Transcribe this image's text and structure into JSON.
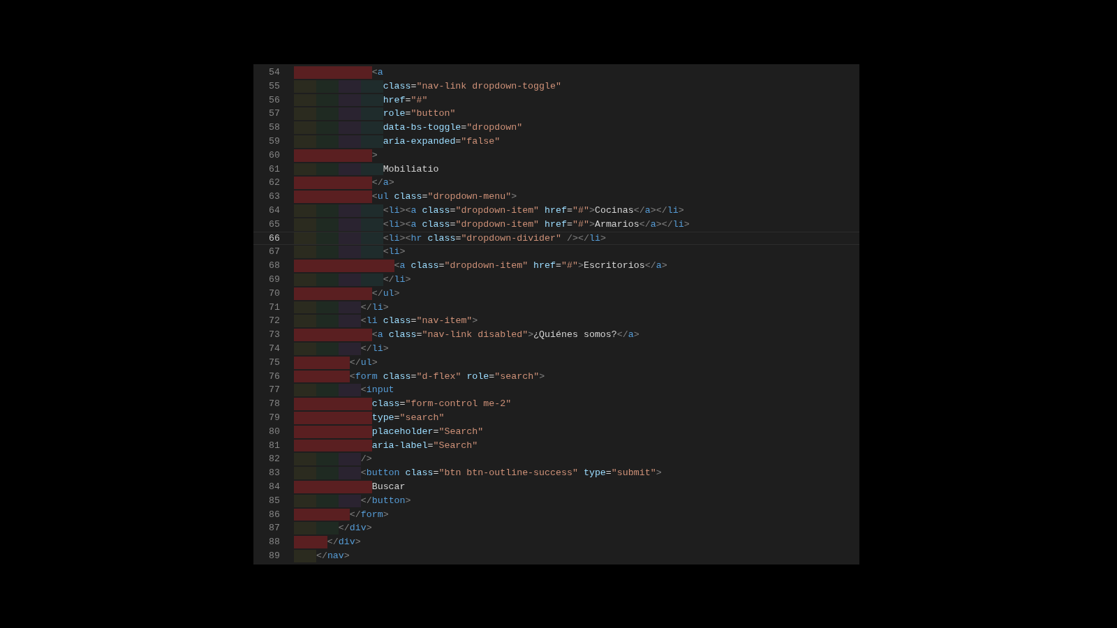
{
  "editor": {
    "lines": [
      {
        "number": "54",
        "current": false,
        "indent_error": true,
        "tokens": [
          {
            "kind": "punct",
            "text": "              <"
          },
          {
            "kind": "tag",
            "text": "a"
          }
        ]
      },
      {
        "number": "55",
        "current": false,
        "indent_error": false,
        "tokens": [
          {
            "kind": "attr",
            "text": "                class"
          },
          {
            "kind": "text",
            "text": "="
          },
          {
            "kind": "string",
            "text": "\"nav-link dropdown-toggle\""
          }
        ]
      },
      {
        "number": "56",
        "current": false,
        "indent_error": false,
        "tokens": [
          {
            "kind": "attr",
            "text": "                href"
          },
          {
            "kind": "text",
            "text": "="
          },
          {
            "kind": "string",
            "text": "\"#\""
          }
        ]
      },
      {
        "number": "57",
        "current": false,
        "indent_error": false,
        "tokens": [
          {
            "kind": "attr",
            "text": "                role"
          },
          {
            "kind": "text",
            "text": "="
          },
          {
            "kind": "string",
            "text": "\"button\""
          }
        ]
      },
      {
        "number": "58",
        "current": false,
        "indent_error": false,
        "tokens": [
          {
            "kind": "attr",
            "text": "                data-bs-toggle"
          },
          {
            "kind": "text",
            "text": "="
          },
          {
            "kind": "string",
            "text": "\"dropdown\""
          }
        ]
      },
      {
        "number": "59",
        "current": false,
        "indent_error": false,
        "tokens": [
          {
            "kind": "attr",
            "text": "                aria-expanded"
          },
          {
            "kind": "text",
            "text": "="
          },
          {
            "kind": "string",
            "text": "\"false\""
          }
        ]
      },
      {
        "number": "60",
        "current": false,
        "indent_error": true,
        "tokens": [
          {
            "kind": "punct",
            "text": "              >"
          }
        ]
      },
      {
        "number": "61",
        "current": false,
        "indent_error": false,
        "tokens": [
          {
            "kind": "text",
            "text": "                Mobiliatio"
          }
        ]
      },
      {
        "number": "62",
        "current": false,
        "indent_error": true,
        "tokens": [
          {
            "kind": "punct",
            "text": "              </"
          },
          {
            "kind": "tag",
            "text": "a"
          },
          {
            "kind": "punct",
            "text": ">"
          }
        ]
      },
      {
        "number": "63",
        "current": false,
        "indent_error": true,
        "tokens": [
          {
            "kind": "punct",
            "text": "              <"
          },
          {
            "kind": "tag",
            "text": "ul "
          },
          {
            "kind": "attr",
            "text": "class"
          },
          {
            "kind": "text",
            "text": "="
          },
          {
            "kind": "string",
            "text": "\"dropdown-menu\""
          },
          {
            "kind": "punct",
            "text": ">"
          }
        ]
      },
      {
        "number": "64",
        "current": false,
        "indent_error": false,
        "tokens": [
          {
            "kind": "punct",
            "text": "                <"
          },
          {
            "kind": "tag",
            "text": "li"
          },
          {
            "kind": "punct",
            "text": "><"
          },
          {
            "kind": "tag",
            "text": "a "
          },
          {
            "kind": "attr",
            "text": "class"
          },
          {
            "kind": "text",
            "text": "="
          },
          {
            "kind": "string",
            "text": "\"dropdown-item\" "
          },
          {
            "kind": "attr",
            "text": "href"
          },
          {
            "kind": "text",
            "text": "="
          },
          {
            "kind": "string",
            "text": "\"#\""
          },
          {
            "kind": "punct",
            "text": ">"
          },
          {
            "kind": "text",
            "text": "Cocinas"
          },
          {
            "kind": "punct",
            "text": "</"
          },
          {
            "kind": "tag",
            "text": "a"
          },
          {
            "kind": "punct",
            "text": "></"
          },
          {
            "kind": "tag",
            "text": "li"
          },
          {
            "kind": "punct",
            "text": ">"
          }
        ]
      },
      {
        "number": "65",
        "current": false,
        "indent_error": false,
        "tokens": [
          {
            "kind": "punct",
            "text": "                <"
          },
          {
            "kind": "tag",
            "text": "li"
          },
          {
            "kind": "punct",
            "text": "><"
          },
          {
            "kind": "tag",
            "text": "a "
          },
          {
            "kind": "attr",
            "text": "class"
          },
          {
            "kind": "text",
            "text": "="
          },
          {
            "kind": "string",
            "text": "\"dropdown-item\" "
          },
          {
            "kind": "attr",
            "text": "href"
          },
          {
            "kind": "text",
            "text": "="
          },
          {
            "kind": "string",
            "text": "\"#\""
          },
          {
            "kind": "punct",
            "text": ">"
          },
          {
            "kind": "text",
            "text": "Armarios"
          },
          {
            "kind": "punct",
            "text": "</"
          },
          {
            "kind": "tag",
            "text": "a"
          },
          {
            "kind": "punct",
            "text": "></"
          },
          {
            "kind": "tag",
            "text": "li"
          },
          {
            "kind": "punct",
            "text": ">"
          }
        ]
      },
      {
        "number": "66",
        "current": true,
        "indent_error": false,
        "tokens": [
          {
            "kind": "punct",
            "text": "                <"
          },
          {
            "kind": "tag",
            "text": "li"
          },
          {
            "kind": "punct",
            "text": "><"
          },
          {
            "kind": "tag",
            "text": "hr "
          },
          {
            "kind": "attr",
            "text": "class"
          },
          {
            "kind": "text",
            "text": "="
          },
          {
            "kind": "string",
            "text": "\"dropdown-divider\" "
          },
          {
            "kind": "punct",
            "text": "/></"
          },
          {
            "kind": "tag",
            "text": "li"
          },
          {
            "kind": "punct",
            "text": ">"
          }
        ]
      },
      {
        "number": "67",
        "current": false,
        "indent_error": false,
        "tokens": [
          {
            "kind": "punct",
            "text": "                <"
          },
          {
            "kind": "tag",
            "text": "li"
          },
          {
            "kind": "punct",
            "text": ">"
          }
        ]
      },
      {
        "number": "68",
        "current": false,
        "indent_error": true,
        "tokens": [
          {
            "kind": "punct",
            "text": "                  <"
          },
          {
            "kind": "tag",
            "text": "a "
          },
          {
            "kind": "attr",
            "text": "class"
          },
          {
            "kind": "text",
            "text": "="
          },
          {
            "kind": "string",
            "text": "\"dropdown-item\" "
          },
          {
            "kind": "attr",
            "text": "href"
          },
          {
            "kind": "text",
            "text": "="
          },
          {
            "kind": "string",
            "text": "\"#\""
          },
          {
            "kind": "punct",
            "text": ">"
          },
          {
            "kind": "text",
            "text": "Escritorios"
          },
          {
            "kind": "punct",
            "text": "</"
          },
          {
            "kind": "tag",
            "text": "a"
          },
          {
            "kind": "punct",
            "text": ">"
          }
        ]
      },
      {
        "number": "69",
        "current": false,
        "indent_error": false,
        "tokens": [
          {
            "kind": "punct",
            "text": "                </"
          },
          {
            "kind": "tag",
            "text": "li"
          },
          {
            "kind": "punct",
            "text": ">"
          }
        ]
      },
      {
        "number": "70",
        "current": false,
        "indent_error": true,
        "tokens": [
          {
            "kind": "punct",
            "text": "              </"
          },
          {
            "kind": "tag",
            "text": "ul"
          },
          {
            "kind": "punct",
            "text": ">"
          }
        ]
      },
      {
        "number": "71",
        "current": false,
        "indent_error": false,
        "tokens": [
          {
            "kind": "punct",
            "text": "            </"
          },
          {
            "kind": "tag",
            "text": "li"
          },
          {
            "kind": "punct",
            "text": ">"
          }
        ]
      },
      {
        "number": "72",
        "current": false,
        "indent_error": false,
        "tokens": [
          {
            "kind": "punct",
            "text": "            <"
          },
          {
            "kind": "tag",
            "text": "li "
          },
          {
            "kind": "attr",
            "text": "class"
          },
          {
            "kind": "text",
            "text": "="
          },
          {
            "kind": "string",
            "text": "\"nav-item\""
          },
          {
            "kind": "punct",
            "text": ">"
          }
        ]
      },
      {
        "number": "73",
        "current": false,
        "indent_error": true,
        "tokens": [
          {
            "kind": "punct",
            "text": "              <"
          },
          {
            "kind": "tag",
            "text": "a "
          },
          {
            "kind": "attr",
            "text": "class"
          },
          {
            "kind": "text",
            "text": "="
          },
          {
            "kind": "string",
            "text": "\"nav-link disabled\""
          },
          {
            "kind": "punct",
            "text": ">"
          },
          {
            "kind": "text",
            "text": "¿Quiénes somos?"
          },
          {
            "kind": "punct",
            "text": "</"
          },
          {
            "kind": "tag",
            "text": "a"
          },
          {
            "kind": "punct",
            "text": ">"
          }
        ]
      },
      {
        "number": "74",
        "current": false,
        "indent_error": false,
        "tokens": [
          {
            "kind": "punct",
            "text": "            </"
          },
          {
            "kind": "tag",
            "text": "li"
          },
          {
            "kind": "punct",
            "text": ">"
          }
        ]
      },
      {
        "number": "75",
        "current": false,
        "indent_error": true,
        "tokens": [
          {
            "kind": "punct",
            "text": "          </"
          },
          {
            "kind": "tag",
            "text": "ul"
          },
          {
            "kind": "punct",
            "text": ">"
          }
        ]
      },
      {
        "number": "76",
        "current": false,
        "indent_error": true,
        "tokens": [
          {
            "kind": "punct",
            "text": "          <"
          },
          {
            "kind": "tag",
            "text": "form "
          },
          {
            "kind": "attr",
            "text": "class"
          },
          {
            "kind": "text",
            "text": "="
          },
          {
            "kind": "string",
            "text": "\"d-flex\" "
          },
          {
            "kind": "attr",
            "text": "role"
          },
          {
            "kind": "text",
            "text": "="
          },
          {
            "kind": "string",
            "text": "\"search\""
          },
          {
            "kind": "punct",
            "text": ">"
          }
        ]
      },
      {
        "number": "77",
        "current": false,
        "indent_error": false,
        "tokens": [
          {
            "kind": "punct",
            "text": "            <"
          },
          {
            "kind": "tag",
            "text": "input"
          }
        ]
      },
      {
        "number": "78",
        "current": false,
        "indent_error": true,
        "tokens": [
          {
            "kind": "attr",
            "text": "              class"
          },
          {
            "kind": "text",
            "text": "="
          },
          {
            "kind": "string",
            "text": "\"form-control me-2\""
          }
        ]
      },
      {
        "number": "79",
        "current": false,
        "indent_error": true,
        "tokens": [
          {
            "kind": "attr",
            "text": "              type"
          },
          {
            "kind": "text",
            "text": "="
          },
          {
            "kind": "string",
            "text": "\"search\""
          }
        ]
      },
      {
        "number": "80",
        "current": false,
        "indent_error": true,
        "tokens": [
          {
            "kind": "attr",
            "text": "              placeholder"
          },
          {
            "kind": "text",
            "text": "="
          },
          {
            "kind": "string",
            "text": "\"Search\""
          }
        ]
      },
      {
        "number": "81",
        "current": false,
        "indent_error": true,
        "tokens": [
          {
            "kind": "attr",
            "text": "              aria-label"
          },
          {
            "kind": "text",
            "text": "="
          },
          {
            "kind": "string",
            "text": "\"Search\""
          }
        ]
      },
      {
        "number": "82",
        "current": false,
        "indent_error": false,
        "tokens": [
          {
            "kind": "punct",
            "text": "            />"
          }
        ]
      },
      {
        "number": "83",
        "current": false,
        "indent_error": false,
        "tokens": [
          {
            "kind": "punct",
            "text": "            <"
          },
          {
            "kind": "tag",
            "text": "button "
          },
          {
            "kind": "attr",
            "text": "class"
          },
          {
            "kind": "text",
            "text": "="
          },
          {
            "kind": "string",
            "text": "\"btn btn-outline-success\" "
          },
          {
            "kind": "attr",
            "text": "type"
          },
          {
            "kind": "text",
            "text": "="
          },
          {
            "kind": "string",
            "text": "\"submit\""
          },
          {
            "kind": "punct",
            "text": ">"
          }
        ]
      },
      {
        "number": "84",
        "current": false,
        "indent_error": true,
        "tokens": [
          {
            "kind": "text",
            "text": "              Buscar"
          }
        ]
      },
      {
        "number": "85",
        "current": false,
        "indent_error": false,
        "tokens": [
          {
            "kind": "punct",
            "text": "            </"
          },
          {
            "kind": "tag",
            "text": "button"
          },
          {
            "kind": "punct",
            "text": ">"
          }
        ]
      },
      {
        "number": "86",
        "current": false,
        "indent_error": true,
        "tokens": [
          {
            "kind": "punct",
            "text": "          </"
          },
          {
            "kind": "tag",
            "text": "form"
          },
          {
            "kind": "punct",
            "text": ">"
          }
        ]
      },
      {
        "number": "87",
        "current": false,
        "indent_error": false,
        "tokens": [
          {
            "kind": "punct",
            "text": "        </"
          },
          {
            "kind": "tag",
            "text": "div"
          },
          {
            "kind": "punct",
            "text": ">"
          }
        ]
      },
      {
        "number": "88",
        "current": false,
        "indent_error": true,
        "tokens": [
          {
            "kind": "punct",
            "text": "      </"
          },
          {
            "kind": "tag",
            "text": "div"
          },
          {
            "kind": "punct",
            "text": ">"
          }
        ]
      },
      {
        "number": "89",
        "current": false,
        "indent_error": false,
        "tokens": [
          {
            "kind": "punct",
            "text": "    </"
          },
          {
            "kind": "tag",
            "text": "nav"
          },
          {
            "kind": "punct",
            "text": ">"
          }
        ]
      }
    ]
  }
}
